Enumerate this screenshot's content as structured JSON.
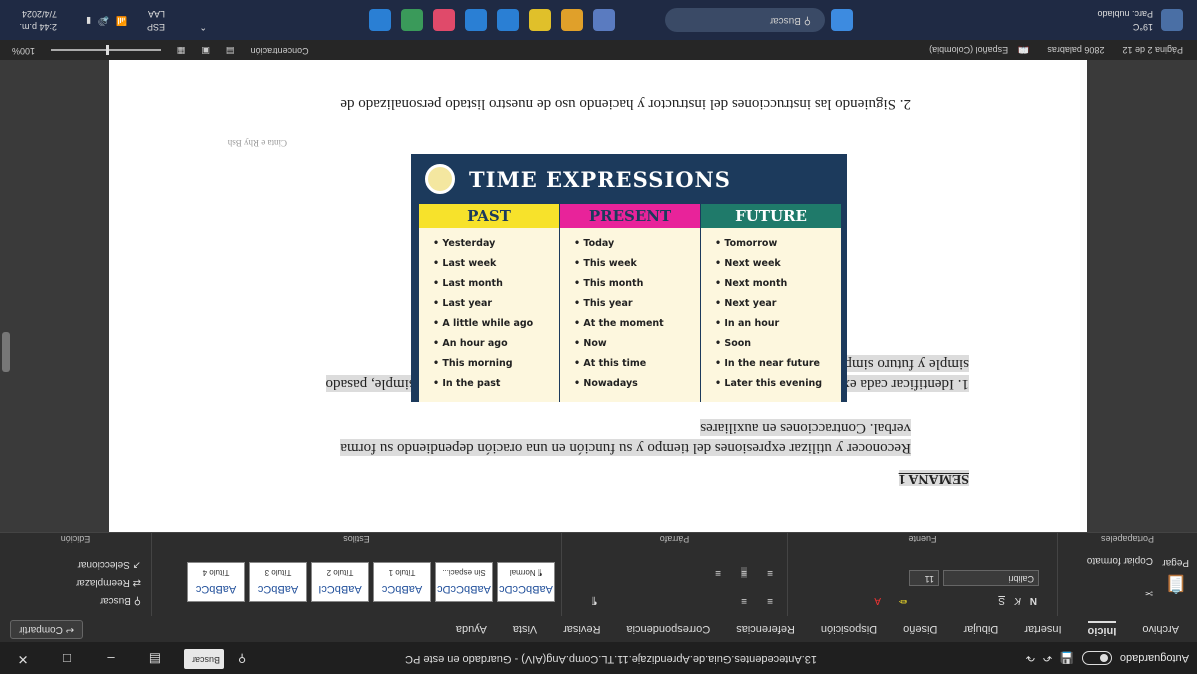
{
  "titlebar": {
    "autosave_label": "Autoguardado",
    "doc_title": "13.Antecedentes.Guia.de.Aprendizaje.11.TL.Comp.Ang(AIV) - Guardado en este PC",
    "search_text": "Buscar"
  },
  "tabs": [
    "Archivo",
    "Inicio",
    "Insertar",
    "Dibujar",
    "Diseño",
    "Disposición",
    "Referencias",
    "Correspondencia",
    "Revisar",
    "Vista",
    "Ayuda"
  ],
  "share_label": "Compartir",
  "ribbon": {
    "clipboard_label": "Portapapeles",
    "paste_label": "Pegar",
    "copy_format_label": "Copiar formato",
    "font_label": "Fuente",
    "font_name": "Calibri",
    "font_size": "11",
    "paragraph_label": "Párrafo",
    "styles_label": "Estilos",
    "editing_label": "Edición",
    "find_label": "Buscar",
    "replace_label": "Reemplazar",
    "select_label": "Seleccionar",
    "styles": [
      {
        "sample": "AaBbCcDc",
        "name": "¶ Normal"
      },
      {
        "sample": "AaBbCcDc",
        "name": "Sin espaci..."
      },
      {
        "sample": "AaBbCc",
        "name": "Título 1"
      },
      {
        "sample": "AaBbCcI",
        "name": "Título 2"
      },
      {
        "sample": "AaBbCc",
        "name": "Título 3"
      },
      {
        "sample": "AaBbCc",
        "name": "Título 4"
      }
    ]
  },
  "document": {
    "heading": "SEMANA 1",
    "para1_line1": "Reconocer y utilizar expresiones del tiempo y su función en una oración dependiendo su forma",
    "para1_line2": "verbal. Contracciones en auxiliares",
    "para2_line1": "1. Identificar cada expresión del tiempo para ubicarla dentro de cada forma verbal (presente simple, pasado",
    "para2_line2": "simple y futuro simple)",
    "para3_line1": "2. Siguiendo las instrucciones del instructor y haciendo uso de nuestro listado personalizado de",
    "caption": "Cinta e Rhy Bsh"
  },
  "image": {
    "title": "TIME EXPRESSIONS",
    "columns": [
      {
        "head": "PAST",
        "color": "#f7e22b",
        "items": [
          "Yesterday",
          "Last week",
          "Last month",
          "Last year",
          "A little while ago",
          "An hour ago",
          "This morning",
          "In the past"
        ]
      },
      {
        "head": "PRESENT",
        "color": "#e8239a",
        "items": [
          "Today",
          "This week",
          "This month",
          "This year",
          "At the moment",
          "Now",
          "At this time",
          "Nowadays"
        ]
      },
      {
        "head": "FUTURE",
        "color": "#1f7a6a",
        "items": [
          "Tomorrow",
          "Next week",
          "Next month",
          "Next year",
          "In an hour",
          "Soon",
          "In the near future",
          "Later this evening"
        ]
      }
    ]
  },
  "statusbar": {
    "page": "Página 2 de 12",
    "words": "2806 palabras",
    "language": "Español (Colombia)",
    "focus": "Concentración",
    "zoom": "100%"
  },
  "taskbar": {
    "weather_temp": "19°C",
    "weather_desc": "Parc. nublado",
    "search_text": "Buscar",
    "lang": "ESP",
    "lang2": "LAA",
    "time": "2:44 p.m.",
    "date": "7/4/2024"
  }
}
